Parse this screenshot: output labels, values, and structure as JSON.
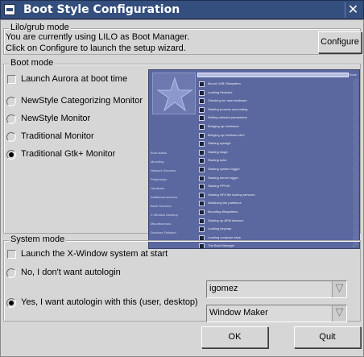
{
  "window": {
    "title": "Boot Style Configuration",
    "close_glyph": "✕"
  },
  "lilo": {
    "group_title": "Lilo/grub mode",
    "line1": "You are currently using LILO as Boot Manager.",
    "line2": "Click on Configure to launch the setup wizard.",
    "configure_label": "Configure"
  },
  "boot": {
    "group_title": "Boot mode",
    "launch_aurora_label": "Launch Aurora at boot time",
    "launch_aurora_checked": false,
    "options": [
      {
        "label": "NewStyle Categorizing Monitor",
        "selected": false
      },
      {
        "label": "NewStyle Monitor",
        "selected": false
      },
      {
        "label": "Traditional Monitor",
        "selected": false
      },
      {
        "label": "Traditional Gtk+ Monitor",
        "selected": true
      }
    ],
    "preview": {
      "status_label": "Done",
      "side_items": [
        "Boot status",
        "Mounting",
        "Network Services",
        "Peripherals",
        "Hardware",
        "Additional services",
        "Base Services",
        "X Window Desktop",
        "Miscellaneous",
        "Services Finished"
      ],
      "rows": [
        "Mount USB Filesystem",
        "Loading Modules",
        "Checking for new hardware",
        "Starting process accounting",
        "Setting network parameters",
        "Bringing up interfaces",
        "Bringing up interface eth0",
        "Starting syslogd",
        "Starting klogd",
        "Starting sshd",
        "Starting system logger",
        "Starting kernel logger",
        "Starting PPPoE",
        "Starting NFS file locking services",
        "Initializing the partitions",
        "Mounting filesystems",
        "Starting up APM daemon",
        "Loading keymap",
        "Loading compose keys",
        "The Boot Manager"
      ]
    }
  },
  "system": {
    "group_title": "System mode",
    "launch_x_label": "Launch the X-Window system at start",
    "launch_x_checked": false,
    "no_autologin_label": "No, I don't want autologin",
    "no_autologin_selected": false,
    "yes_autologin_label": "Yes, I want autologin with this (user, desktop)",
    "yes_autologin_selected": true,
    "user_value": "igomez",
    "desktop_value": "Window Maker",
    "dropdown_glyph": "▽"
  },
  "footer": {
    "ok_label": "OK",
    "quit_label": "Quit"
  },
  "colors": {
    "titlebar": "#344e7d",
    "background": "#d6d6d6",
    "preview": "#5b679f",
    "status_ok": "#65dc59"
  }
}
